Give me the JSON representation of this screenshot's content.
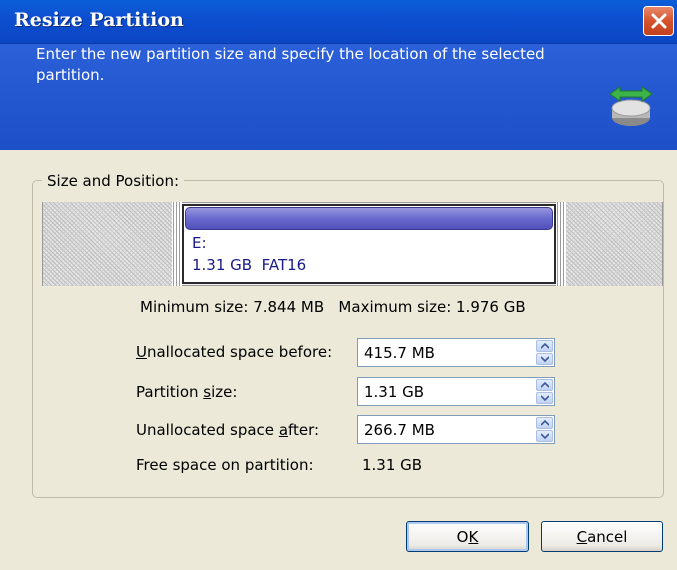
{
  "window": {
    "title": "Resize Partition"
  },
  "header": {
    "description": "Enter the new partition size and specify the location of the selected partition."
  },
  "group": {
    "label": "Size and Position:"
  },
  "partition": {
    "letter": "E:",
    "info": "1.31 GB  FAT16"
  },
  "limits": {
    "text": "Minimum size: 7.844 MB   Maximum size: 1.976 GB"
  },
  "fields": {
    "before": {
      "label_pre": "",
      "label_key": "U",
      "label_post": "nallocated space before:",
      "value": "415.7 MB"
    },
    "size": {
      "label_pre": "Partition ",
      "label_key": "s",
      "label_post": "ize:",
      "value": "1.31 GB"
    },
    "after": {
      "label_pre": "Unallocated space ",
      "label_key": "a",
      "label_post": "fter:",
      "value": "266.7 MB"
    }
  },
  "free": {
    "label": "Free space on partition:",
    "value": "1.31 GB"
  },
  "buttons": {
    "ok_pre": "O",
    "ok_key": "K",
    "cancel_key": "C",
    "cancel_post": "ancel"
  },
  "colors": {
    "title_bar": "#0b46c4",
    "header_bg": "#1c4fc8",
    "dialog_bg": "#ece9d8",
    "partition_fill": "#6a6ad0",
    "partition_text": "#1a1a8a",
    "close_button": "#d4532e"
  },
  "icons": {
    "close": "close-icon",
    "header": "drive-resize-icon",
    "spin_up": "arrow-up-icon",
    "spin_down": "arrow-down-icon"
  }
}
